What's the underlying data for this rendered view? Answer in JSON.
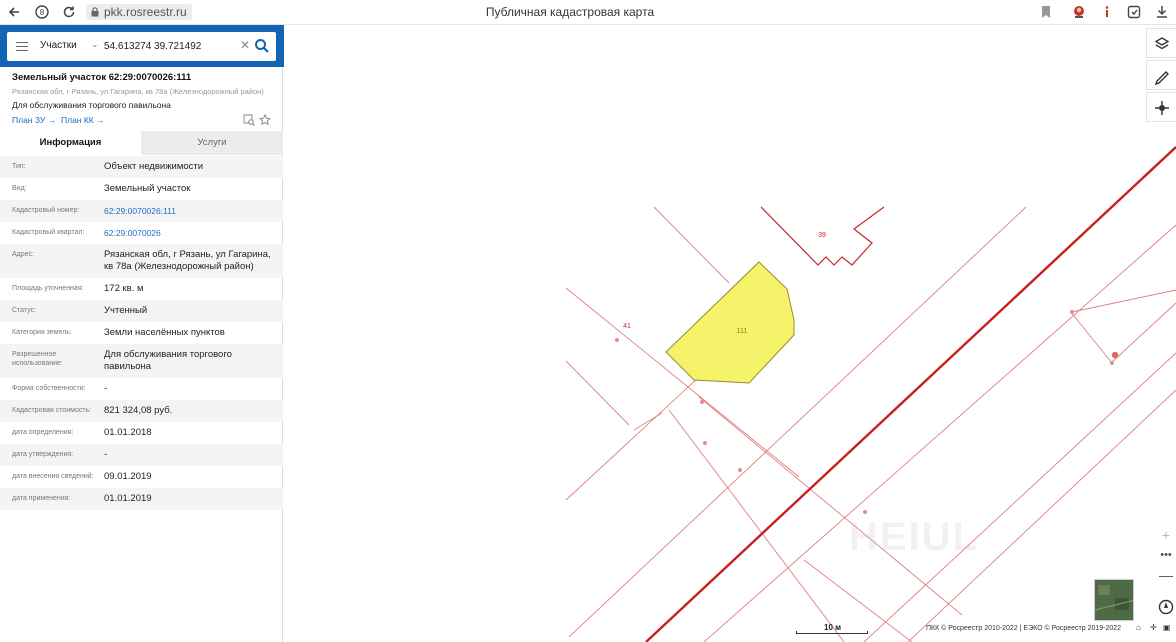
{
  "browser": {
    "url": "pkk.rosreestr.ru",
    "page_title": "Публичная кадастровая карта"
  },
  "search": {
    "type_label": "Участки",
    "query": "54.613274 39.721492"
  },
  "object": {
    "title": "Земельный участок 62:29:0070026:111",
    "address": "Рязанская обл, г Рязань, ул Гагарина, кв 78а (Железнодорожный район)",
    "purpose": "Для обслуживания торгового павильона",
    "plan_zu_link": "План ЗУ →",
    "plan_kk_link": "План КК →"
  },
  "tabs": {
    "info": "Информация",
    "services": "Услуги"
  },
  "info_rows": [
    {
      "label": "Тип:",
      "value": "Объект недвижимости"
    },
    {
      "label": "Вид:",
      "value": "Земельный участок"
    },
    {
      "label": "Кадастровый номер:",
      "value": "62:29:0070026:111"
    },
    {
      "label": "Кадастровый квартал:",
      "value": "62:29:0070026"
    },
    {
      "label": "Адрес:",
      "value": "Рязанская обл, г Рязань, ул Гагарина, кв 78а (Железнодорожный район)"
    },
    {
      "label": "Площадь уточненная:",
      "value": "172 кв. м"
    },
    {
      "label": "Статус:",
      "value": "Учтенный"
    },
    {
      "label": "Категория земель:",
      "value": "Земли населённых пунктов"
    },
    {
      "label": "Разрешенное использование:",
      "value": "Для обслуживания торгового павильона"
    },
    {
      "label": "Форма собственности:",
      "value": "-"
    },
    {
      "label": "Кадастровая стоимость:",
      "value": "821 324,08 руб."
    },
    {
      "label": "дата определения:",
      "value": "01.01.2018"
    },
    {
      "label": "дата утверждения:",
      "value": "-"
    },
    {
      "label": "дата внесения сведений:",
      "value": "09.01.2019"
    },
    {
      "label": "дата применения:",
      "value": "01.01.2019"
    }
  ],
  "map": {
    "parcel_labels": {
      "selected": "111",
      "north": "39",
      "west": "41"
    },
    "scale_label": "10 м",
    "attribution": "ПКК © Росреестр 2010-2022 | ЕЭКО © Росреестр 2019-2022",
    "watermark": "HEIUL",
    "colors": {
      "parcel_fill": "#f4f36a",
      "boundary": "#d94a4a",
      "thick_boundary": "#c81e1e",
      "header_blue": "#1464b4",
      "link_blue": "#1a6fc2"
    }
  }
}
